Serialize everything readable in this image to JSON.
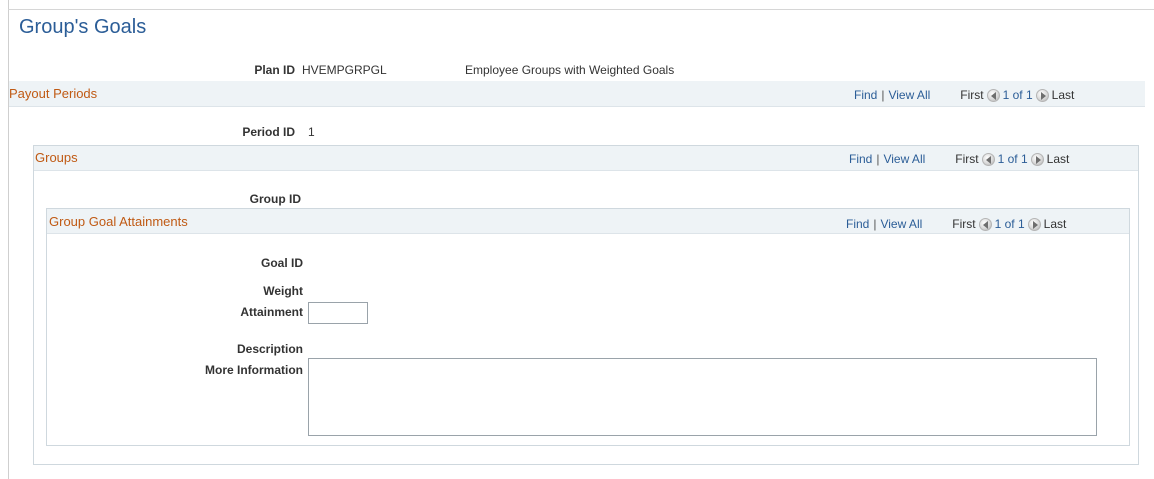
{
  "page": {
    "title": "Group's Goals"
  },
  "plan": {
    "label": "Plan ID",
    "value": "HVEMPGRPGL",
    "description": "Employee Groups with Weighted Goals"
  },
  "payout_periods": {
    "title": "Payout Periods",
    "nav": {
      "find": "Find",
      "separator": "|",
      "view_all": "View All",
      "first": "First",
      "count": "1 of 1",
      "last": "Last"
    },
    "period_label": "Period ID",
    "period_value": "1"
  },
  "groups": {
    "title": "Groups",
    "nav": {
      "find": "Find",
      "separator": "|",
      "view_all": "View All",
      "first": "First",
      "count": "1 of 1",
      "last": "Last"
    },
    "group_label": "Group ID",
    "group_value": ""
  },
  "goal_attainments": {
    "title": "Group Goal Attainments",
    "nav": {
      "find": "Find",
      "separator": "|",
      "view_all": "View All",
      "first": "First",
      "count": "1 of 1",
      "last": "Last"
    },
    "goal_label": "Goal ID",
    "weight_label": "Weight",
    "attainment_label": "Attainment",
    "attainment_value": "",
    "description_label": "Description",
    "more_info_label": "More Information",
    "more_info_value": ""
  },
  "icons": {
    "prev": "previous-arrow-icon",
    "next": "next-arrow-icon"
  }
}
